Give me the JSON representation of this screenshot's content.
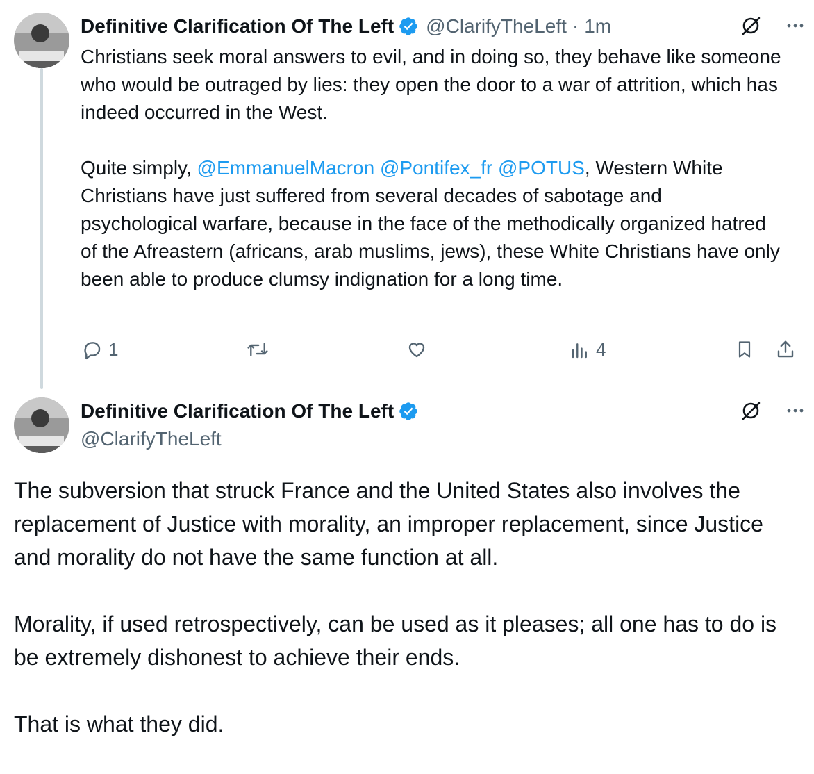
{
  "tweet1": {
    "author_name": "Definitive Clarification Of The Left",
    "handle": "@ClarifyTheLeft",
    "separator": "·",
    "time": "1m",
    "paragraph1": "Christians seek moral answers to evil, and in doing so, they behave like someone who would be outraged by lies: they open the door to a war of attrition, which has indeed occurred in the West.",
    "paragraph2_prefix": "Quite simply, ",
    "mentions": [
      "@EmmanuelMacron",
      "@Pontifex_fr",
      "@POTUS"
    ],
    "paragraph2_suffix": ", Western White Christians have just suffered from several decades of sabotage and psychological warfare, because in the face of the methodically organized hatred of the Afreastern (africans, arab muslims, jews), these White Christians have only been able to produce clumsy indignation for a long time.",
    "reply_count": "1",
    "views_count": "4"
  },
  "tweet2": {
    "author_name": "Definitive Clarification Of The Left",
    "handle": "@ClarifyTheLeft",
    "paragraphs": [
      "The subversion that struck France and the United States also involves the replacement of Justice with morality, an improper replacement, since Justice and morality do not have the same function at all.",
      "Morality, if used retrospectively, can be used as it pleases; all one has to do is be extremely dishonest to achieve their ends.",
      "That is what they did."
    ]
  },
  "icons": {
    "verified": "verified-badge-icon",
    "grok": "grok-icon",
    "more": "more-icon",
    "reply": "reply-icon",
    "retweet": "retweet-icon",
    "like": "like-icon",
    "views": "views-icon",
    "bookmark": "bookmark-icon",
    "share": "share-icon"
  },
  "colors": {
    "accent": "#1d9bf0",
    "secondary_text": "#536471",
    "thread_line": "#cfd9de"
  }
}
